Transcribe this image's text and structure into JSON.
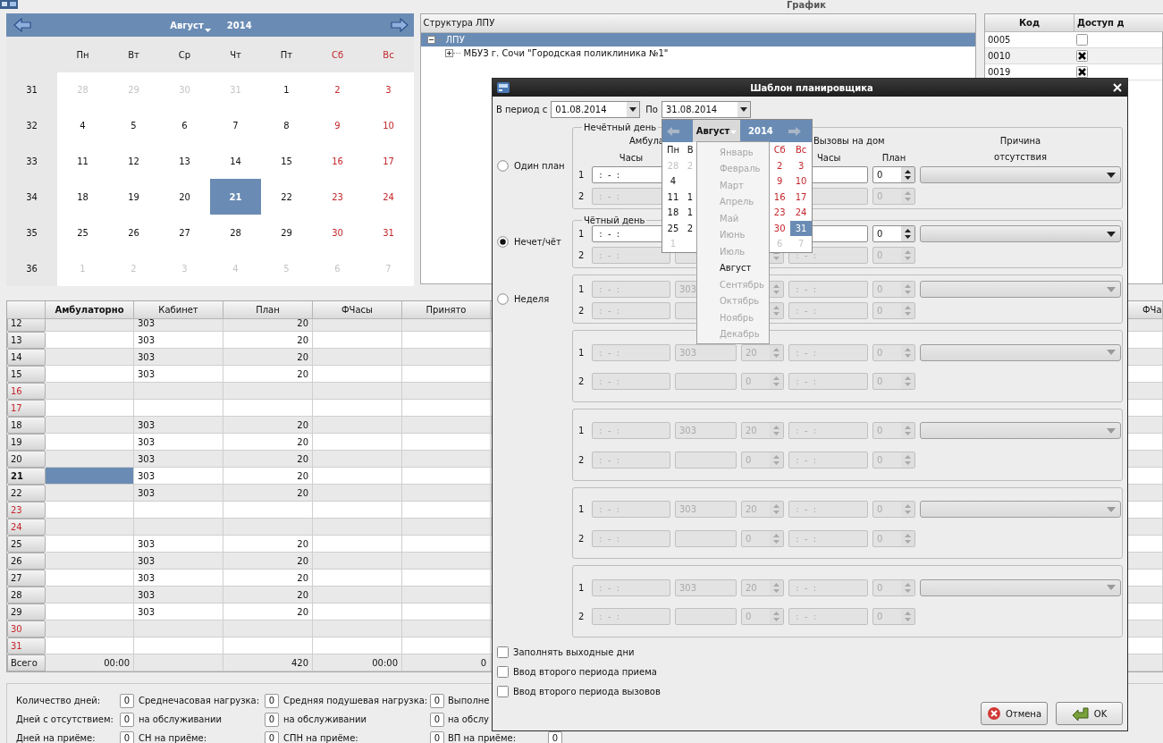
{
  "window": {
    "title": "График"
  },
  "calendar": {
    "month": "Август",
    "year": "2014",
    "weekdays": [
      {
        "label": "Пн",
        "weekend": false
      },
      {
        "label": "Вт",
        "weekend": false
      },
      {
        "label": "Ср",
        "weekend": false
      },
      {
        "label": "Чт",
        "weekend": false
      },
      {
        "label": "Пт",
        "weekend": false
      },
      {
        "label": "Сб",
        "weekend": true
      },
      {
        "label": "Вс",
        "weekend": true
      }
    ],
    "weeks": [
      {
        "num": "31",
        "days": [
          {
            "text": "28",
            "muted": true,
            "selected": false
          },
          {
            "text": "29",
            "muted": true,
            "selected": false
          },
          {
            "text": "30",
            "muted": true,
            "selected": false
          },
          {
            "text": "31",
            "muted": true,
            "selected": false
          },
          {
            "text": "1",
            "muted": false,
            "selected": false
          },
          {
            "text": "2",
            "muted": false,
            "selected": false
          },
          {
            "text": "3",
            "muted": false,
            "selected": false
          }
        ]
      },
      {
        "num": "32",
        "days": [
          {
            "text": "4",
            "muted": false,
            "selected": false
          },
          {
            "text": "5",
            "muted": false,
            "selected": false
          },
          {
            "text": "6",
            "muted": false,
            "selected": false
          },
          {
            "text": "7",
            "muted": false,
            "selected": false
          },
          {
            "text": "8",
            "muted": false,
            "selected": false
          },
          {
            "text": "9",
            "muted": false,
            "selected": false
          },
          {
            "text": "10",
            "muted": false,
            "selected": false
          }
        ]
      },
      {
        "num": "33",
        "days": [
          {
            "text": "11",
            "muted": false,
            "selected": false
          },
          {
            "text": "12",
            "muted": false,
            "selected": false
          },
          {
            "text": "13",
            "muted": false,
            "selected": false
          },
          {
            "text": "14",
            "muted": false,
            "selected": false
          },
          {
            "text": "15",
            "muted": false,
            "selected": false
          },
          {
            "text": "16",
            "muted": false,
            "selected": false
          },
          {
            "text": "17",
            "muted": false,
            "selected": false
          }
        ]
      },
      {
        "num": "34",
        "days": [
          {
            "text": "18",
            "muted": false,
            "selected": false
          },
          {
            "text": "19",
            "muted": false,
            "selected": false
          },
          {
            "text": "20",
            "muted": false,
            "selected": false
          },
          {
            "text": "21",
            "muted": false,
            "selected": true
          },
          {
            "text": "22",
            "muted": false,
            "selected": false
          },
          {
            "text": "23",
            "muted": false,
            "selected": false
          },
          {
            "text": "24",
            "muted": false,
            "selected": false
          }
        ]
      },
      {
        "num": "35",
        "days": [
          {
            "text": "25",
            "muted": false,
            "selected": false
          },
          {
            "text": "26",
            "muted": false,
            "selected": false
          },
          {
            "text": "27",
            "muted": false,
            "selected": false
          },
          {
            "text": "28",
            "muted": false,
            "selected": false
          },
          {
            "text": "29",
            "muted": false,
            "selected": false
          },
          {
            "text": "30",
            "muted": false,
            "selected": false
          },
          {
            "text": "31",
            "muted": false,
            "selected": false
          }
        ]
      },
      {
        "num": "36",
        "days": [
          {
            "text": "1",
            "muted": true,
            "selected": false
          },
          {
            "text": "2",
            "muted": true,
            "selected": false
          },
          {
            "text": "3",
            "muted": true,
            "selected": false
          },
          {
            "text": "4",
            "muted": true,
            "selected": false
          },
          {
            "text": "5",
            "muted": true,
            "selected": false
          },
          {
            "text": "6",
            "muted": true,
            "selected": false
          },
          {
            "text": "7",
            "muted": true,
            "selected": false
          }
        ]
      }
    ]
  },
  "tree": {
    "header": "Структура ЛПУ",
    "items": [
      {
        "label": "ЛПУ",
        "selected": true,
        "expanded": true,
        "children": [
          {
            "label": "МБУЗ г. Сочи \"Городская поликлиника №1\"",
            "selected": false,
            "expanded": false
          }
        ]
      }
    ]
  },
  "access_table": {
    "columns": [
      "Код",
      "Доступ д"
    ],
    "rows": [
      {
        "code": "0005",
        "checked": false
      },
      {
        "code": "0010",
        "checked": true
      },
      {
        "code": "0019",
        "checked": true
      }
    ]
  },
  "schedule": {
    "columns": [
      {
        "label": "Амбулаторно",
        "selected": true
      },
      {
        "label": "Кабинет",
        "selected": false
      },
      {
        "label": "План",
        "selected": false
      },
      {
        "label": "ФЧасы",
        "selected": false
      },
      {
        "label": "Принято",
        "selected": false
      }
    ],
    "far_column": {
      "label": "ФЧа",
      "selected": false
    },
    "rows": [
      {
        "day": "12",
        "weekend": false,
        "selected": false,
        "cabinet": "303",
        "plan": "20"
      },
      {
        "day": "13",
        "weekend": false,
        "selected": false,
        "cabinet": "303",
        "plan": "20"
      },
      {
        "day": "14",
        "weekend": false,
        "selected": false,
        "cabinet": "303",
        "plan": "20"
      },
      {
        "day": "15",
        "weekend": false,
        "selected": false,
        "cabinet": "303",
        "plan": "20"
      },
      {
        "day": "16",
        "weekend": true,
        "selected": false
      },
      {
        "day": "17",
        "weekend": true,
        "selected": false
      },
      {
        "day": "18",
        "weekend": false,
        "selected": false,
        "cabinet": "303",
        "plan": "20"
      },
      {
        "day": "19",
        "weekend": false,
        "selected": false,
        "cabinet": "303",
        "plan": "20"
      },
      {
        "day": "20",
        "weekend": false,
        "selected": false,
        "cabinet": "303",
        "plan": "20"
      },
      {
        "day": "21",
        "weekend": false,
        "selected": true,
        "cabinet": "303",
        "plan": "20"
      },
      {
        "day": "22",
        "weekend": false,
        "selected": false,
        "cabinet": "303",
        "plan": "20"
      },
      {
        "day": "23",
        "weekend": true,
        "selected": false
      },
      {
        "day": "24",
        "weekend": true,
        "selected": false
      },
      {
        "day": "25",
        "weekend": false,
        "selected": false,
        "cabinet": "303",
        "plan": "20"
      },
      {
        "day": "26",
        "weekend": false,
        "selected": false,
        "cabinet": "303",
        "plan": "20"
      },
      {
        "day": "27",
        "weekend": false,
        "selected": false,
        "cabinet": "303",
        "plan": "20"
      },
      {
        "day": "28",
        "weekend": false,
        "selected": false,
        "cabinet": "303",
        "plan": "20"
      },
      {
        "day": "29",
        "weekend": false,
        "selected": false,
        "cabinet": "303",
        "plan": "20"
      },
      {
        "day": "30",
        "weekend": true,
        "selected": false
      },
      {
        "day": "31",
        "weekend": true,
        "selected": false
      }
    ],
    "total": {
      "label": "Всего",
      "amb": "00:00",
      "plan": "420",
      "fhours": "00:00",
      "accepted": "0"
    }
  },
  "stats": [
    [
      {
        "label": "Количество дней:",
        "value": "0"
      },
      {
        "label": "Среднечасовая нагрузка:",
        "value": "0"
      },
      {
        "label": "Средняя подушевая нагрузка:",
        "value": "0"
      },
      {
        "label": "Выполне"
      }
    ],
    [
      {
        "label": "Дней с отсутствием:",
        "value": "0"
      },
      {
        "label": "на обслуживании",
        "value": "0"
      },
      {
        "label": "на обслуживании",
        "value": "0"
      },
      {
        "label": "на обслу"
      }
    ],
    [
      {
        "label": "Дней на приёме:",
        "value": "0"
      },
      {
        "label": "СН на приёме:",
        "value": "0"
      },
      {
        "label": "СПН на приёме:",
        "value": "0"
      },
      {
        "label": "ВП на приёме:",
        "value": "0"
      }
    ]
  ],
  "dialog": {
    "title": "Шаблон планировщика",
    "period": {
      "from_label": "В период с",
      "from": "01.08.2014",
      "to_label": "По",
      "to": "31.08.2014"
    },
    "groups": [
      {
        "legend": "Нечётный день",
        "radio": {
          "label": "Один план",
          "selected": false
        },
        "headers": {
          "amb": "Амбула",
          "amb_hours": "Часы",
          "calls": "Вызовы на дом",
          "calls_hours": "Часы",
          "calls_plan": "План",
          "reason": "Причина отсутствия"
        },
        "rows": [
          {
            "num": "1",
            "enabled": true,
            "time": " :  -  :",
            "calls_plan": "0",
            "reason": true
          },
          {
            "num": "2",
            "enabled": false,
            "time": " :  -  :",
            "calls_plan": "0",
            "reason": false
          }
        ]
      },
      {
        "legend": "Чётный день",
        "radio": {
          "label": "Нечет/чёт",
          "selected": true
        },
        "rows": [
          {
            "num": "1",
            "enabled": true,
            "time": " :  -  :",
            "calls_plan": "0",
            "reason": true
          },
          {
            "num": "2",
            "enabled": false,
            "time": " :  -  :",
            "calls_time": " :  -  :",
            "calls_plan": "0",
            "reason": false
          }
        ]
      },
      {
        "radio": {
          "label": "Неделя",
          "selected": false
        },
        "rows": [
          {
            "num": "1",
            "enabled": false,
            "time": " :  -  :",
            "cabinet": "303",
            "calls_time": " :  -  :",
            "calls_plan": "0",
            "reason": true
          },
          {
            "num": "2",
            "enabled": false,
            "time": " :  -  :",
            "calls_time": " :  -  :",
            "calls_plan": "0",
            "reason": false
          }
        ]
      },
      {
        "rows": [
          {
            "num": "1",
            "enabled": false,
            "time": " :  -  :",
            "cabinet": "303",
            "plan": "20",
            "calls_time": " :  -  :",
            "calls_plan": "0",
            "reason": true
          },
          {
            "num": "2",
            "enabled": false,
            "time": " :  -  :",
            "plan": "0",
            "calls_time": " :  -  :",
            "calls_plan": "0",
            "reason": false
          }
        ]
      },
      {
        "rows": [
          {
            "num": "1",
            "enabled": false,
            "time": " :  -  :",
            "cabinet": "303",
            "plan": "20",
            "calls_time": " :  -  :",
            "calls_plan": "0",
            "reason": true
          },
          {
            "num": "2",
            "enabled": false,
            "time": " :  -  :",
            "plan": "0",
            "calls_time": " :  -  :",
            "calls_plan": "0",
            "reason": false
          }
        ]
      },
      {
        "rows": [
          {
            "num": "1",
            "enabled": false,
            "time": " :  -  :",
            "cabinet": "303",
            "plan": "20",
            "calls_time": " :  -  :",
            "calls_plan": "0",
            "reason": true
          },
          {
            "num": "2",
            "enabled": false,
            "time": " :  -  :",
            "plan": "0",
            "calls_time": " :  -  :",
            "calls_plan": "0",
            "reason": false
          }
        ]
      },
      {
        "rows": [
          {
            "num": "1",
            "enabled": false,
            "time": " :  -  :",
            "cabinet": "303",
            "plan": "20",
            "calls_time": " :  -  :",
            "calls_plan": "0",
            "reason": true
          },
          {
            "num": "2",
            "enabled": false,
            "time": " :  -  :",
            "plan": "0",
            "calls_time": " :  -  :",
            "calls_plan": "0",
            "reason": false
          }
        ]
      }
    ],
    "checks": [
      {
        "label": "Заполнять выходные дни",
        "checked": false
      },
      {
        "label": "Ввод второго периода приема",
        "checked": false
      },
      {
        "label": "Ввод второго периода вызовов",
        "checked": false
      }
    ],
    "buttons": [
      {
        "label": "Отмена",
        "kind": "cancel"
      },
      {
        "label": "OK",
        "kind": "ok"
      }
    ],
    "popup": {
      "month": "Август",
      "year": "2014",
      "weekdays": {
        "left": [
          {
            "label": "Пн",
            "weekend": false
          },
          {
            "label": "В",
            "weekend": false
          }
        ],
        "right": [
          {
            "label": "Сб",
            "weekend": true
          },
          {
            "label": "Вс",
            "weekend": true
          }
        ]
      },
      "weeks": [
        {
          "left": [
            {
              "text": "28",
              "muted": true,
              "selected": false
            },
            {
              "text": "2",
              "muted": true,
              "selected": false
            }
          ],
          "right": [
            {
              "text": "2",
              "muted": false,
              "selected": false
            },
            {
              "text": "3",
              "muted": false,
              "selected": false
            }
          ]
        },
        {
          "left": [
            {
              "text": "4",
              "muted": false,
              "selected": false
            }
          ],
          "right": [
            {
              "text": "9",
              "muted": false,
              "selected": false
            },
            {
              "text": "10",
              "muted": false,
              "selected": false
            }
          ]
        },
        {
          "left": [
            {
              "text": "11",
              "muted": false,
              "selected": false
            },
            {
              "text": "1",
              "muted": false,
              "selected": false
            }
          ],
          "right": [
            {
              "text": "16",
              "muted": false,
              "selected": false
            },
            {
              "text": "17",
              "muted": false,
              "selected": false
            }
          ]
        },
        {
          "left": [
            {
              "text": "18",
              "muted": false,
              "selected": false
            },
            {
              "text": "1",
              "muted": false,
              "selected": false
            }
          ],
          "right": [
            {
              "text": "23",
              "muted": false,
              "selected": false
            },
            {
              "text": "24",
              "muted": false,
              "selected": false
            }
          ]
        },
        {
          "left": [
            {
              "text": "25",
              "muted": false,
              "selected": false
            },
            {
              "text": "2",
              "muted": false,
              "selected": false
            }
          ],
          "right": [
            {
              "text": "30",
              "muted": false,
              "selected": false
            },
            {
              "text": "31",
              "muted": false,
              "selected": true
            }
          ]
        },
        {
          "left": [
            {
              "text": "1",
              "muted": true,
              "selected": false
            }
          ],
          "right": [
            {
              "text": "6",
              "muted": true,
              "selected": false
            },
            {
              "text": "7",
              "muted": true,
              "selected": false
            }
          ]
        }
      ]
    },
    "month_menu": [
      {
        "label": "Январь",
        "disabled": true
      },
      {
        "label": "Февраль",
        "disabled": true
      },
      {
        "label": "Март",
        "disabled": true
      },
      {
        "label": "Апрель",
        "disabled": true
      },
      {
        "label": "Май",
        "disabled": true
      },
      {
        "label": "Июнь",
        "disabled": true
      },
      {
        "label": "Июль",
        "disabled": true
      },
      {
        "label": "Август",
        "disabled": false
      },
      {
        "label": "Сентябрь",
        "disabled": true
      },
      {
        "label": "Октябрь",
        "disabled": true
      },
      {
        "label": "Ноябрь",
        "disabled": true
      },
      {
        "label": "Декабрь",
        "disabled": true
      }
    ]
  }
}
